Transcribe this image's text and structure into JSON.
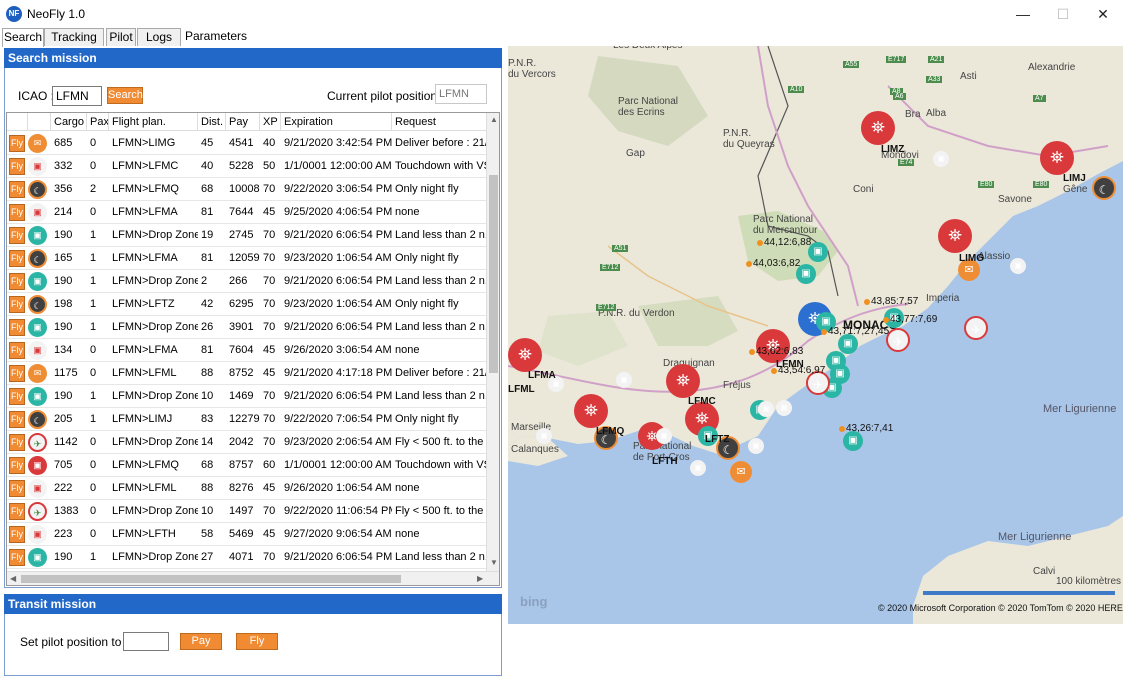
{
  "window": {
    "title": "NeoFly 1.0",
    "minimize": "—",
    "maximize": "☐",
    "close": "✕"
  },
  "tabs": [
    "Search",
    "Tracking",
    "Pilot",
    "Logs",
    "Parameters"
  ],
  "search_mission": {
    "header": "Search mission",
    "icao_label": "ICAO :",
    "icao_value": "LFMN",
    "search_button": "Search",
    "current_pos_label": "Current pilot position :",
    "current_pos_placeholder": "LFMN"
  },
  "grid": {
    "fly_label": "Fly",
    "columns": [
      "Cargo",
      "Pax",
      "Flight plan.",
      "Dist.",
      "Pay",
      "XP",
      "Expiration",
      "Request"
    ],
    "rows": [
      {
        "icon": "mail",
        "cargo": "685",
        "pax": "0",
        "plan": "LFMN>LIMG",
        "dist": "45",
        "pay": "4541",
        "xp": "40",
        "exp": "9/21/2020 3:42:54 PM",
        "req": "Deliver before : 21/0"
      },
      {
        "icon": "cargo",
        "cargo": "332",
        "pax": "0",
        "plan": "LFMN>LFMC",
        "dist": "40",
        "pay": "5228",
        "xp": "50",
        "exp": "1/1/0001 12:00:00 AM",
        "req": "Touchdown with VS"
      },
      {
        "icon": "night",
        "cargo": "356",
        "pax": "2",
        "plan": "LFMN>LFMQ",
        "dist": "68",
        "pay": "10008",
        "xp": "70",
        "exp": "9/22/2020 3:06:54 PM",
        "req": "Only night fly"
      },
      {
        "icon": "cargo",
        "cargo": "214",
        "pax": "0",
        "plan": "LFMN>LFMA",
        "dist": "81",
        "pay": "7644",
        "xp": "45",
        "exp": "9/25/2020 4:06:54 PM",
        "req": "none"
      },
      {
        "icon": "drop",
        "cargo": "190",
        "pax": "1",
        "plan": "LFMN>Drop Zone",
        "dist": "19",
        "pay": "2745",
        "xp": "70",
        "exp": "9/21/2020 6:06:54 PM",
        "req": "Land less than 2 n.m"
      },
      {
        "icon": "night",
        "cargo": "165",
        "pax": "1",
        "plan": "LFMN>LFMA",
        "dist": "81",
        "pay": "12059",
        "xp": "70",
        "exp": "9/23/2020 1:06:54 AM",
        "req": "Only night fly"
      },
      {
        "icon": "drop",
        "cargo": "190",
        "pax": "1",
        "plan": "LFMN>Drop Zone",
        "dist": "2",
        "pay": "266",
        "xp": "70",
        "exp": "9/21/2020 6:06:54 PM",
        "req": "Land less than 2 n.m"
      },
      {
        "icon": "night",
        "cargo": "198",
        "pax": "1",
        "plan": "LFMN>LFTZ",
        "dist": "42",
        "pay": "6295",
        "xp": "70",
        "exp": "9/23/2020 1:06:54 AM",
        "req": "Only night fly"
      },
      {
        "icon": "drop",
        "cargo": "190",
        "pax": "1",
        "plan": "LFMN>Drop Zone",
        "dist": "26",
        "pay": "3901",
        "xp": "70",
        "exp": "9/21/2020 6:06:54 PM",
        "req": "Land less than 2 n.m"
      },
      {
        "icon": "cargo",
        "cargo": "134",
        "pax": "0",
        "plan": "LFMN>LFMA",
        "dist": "81",
        "pay": "7604",
        "xp": "45",
        "exp": "9/26/2020 3:06:54 AM",
        "req": "none"
      },
      {
        "icon": "mail",
        "cargo": "1175",
        "pax": "0",
        "plan": "LFMN>LFML",
        "dist": "88",
        "pay": "8752",
        "xp": "45",
        "exp": "9/21/2020 4:17:18 PM",
        "req": "Deliver before : 21/0"
      },
      {
        "icon": "drop",
        "cargo": "190",
        "pax": "1",
        "plan": "LFMN>Drop Zone",
        "dist": "10",
        "pay": "1469",
        "xp": "70",
        "exp": "9/21/2020 6:06:54 PM",
        "req": "Land less than 2 n.m"
      },
      {
        "icon": "night",
        "cargo": "205",
        "pax": "1",
        "plan": "LFMN>LIMJ",
        "dist": "83",
        "pay": "12279",
        "xp": "70",
        "exp": "9/22/2020 7:06:54 PM",
        "req": "Only night fly"
      },
      {
        "icon": "lowfly",
        "cargo": "1142",
        "pax": "0",
        "plan": "LFMN>Drop Zone",
        "dist": "14",
        "pay": "2042",
        "xp": "70",
        "exp": "9/23/2020 2:06:54 AM",
        "req": "Fly < 500 ft. to the D"
      },
      {
        "icon": "touch",
        "cargo": "705",
        "pax": "0",
        "plan": "LFMN>LFMQ",
        "dist": "68",
        "pay": "8757",
        "xp": "60",
        "exp": "1/1/0001 12:00:00 AM",
        "req": "Touchdown with VS"
      },
      {
        "icon": "cargo",
        "cargo": "222",
        "pax": "0",
        "plan": "LFMN>LFML",
        "dist": "88",
        "pay": "8276",
        "xp": "45",
        "exp": "9/26/2020 1:06:54 AM",
        "req": "none"
      },
      {
        "icon": "lowfly",
        "cargo": "1383",
        "pax": "0",
        "plan": "LFMN>Drop Zone",
        "dist": "10",
        "pay": "1497",
        "xp": "70",
        "exp": "9/22/2020 11:06:54 PM",
        "req": "Fly < 500 ft. to the D"
      },
      {
        "icon": "cargo",
        "cargo": "223",
        "pax": "0",
        "plan": "LFMN>LFTH",
        "dist": "58",
        "pay": "5469",
        "xp": "45",
        "exp": "9/27/2020 9:06:54 AM",
        "req": "none"
      },
      {
        "icon": "drop",
        "cargo": "190",
        "pax": "1",
        "plan": "LFMN>Drop Zone",
        "dist": "27",
        "pay": "4071",
        "xp": "70",
        "exp": "9/21/2020 6:06:54 PM",
        "req": "Land less than 2 n.m"
      }
    ]
  },
  "transit_mission": {
    "header": "Transit mission",
    "set_pos_label": "Set pilot position to :",
    "pos_value": "",
    "pay_button": "Pay",
    "fly_button": "Fly"
  },
  "map": {
    "place_labels": [
      {
        "t": "Les Deux Alpes"
      },
      {
        "t": "P.N.R.\ndu Vercors"
      },
      {
        "t": "Parc National\ndes Ecrins"
      },
      {
        "t": "P.N.R.\ndu Queyras"
      },
      {
        "t": "Gap"
      },
      {
        "t": "Alexandrie"
      },
      {
        "t": "Asti"
      },
      {
        "t": "Alba"
      },
      {
        "t": "Bra"
      },
      {
        "t": "Coni"
      },
      {
        "t": "Mondovi"
      },
      {
        "t": "Savone"
      },
      {
        "t": "Gêne"
      },
      {
        "t": "Parc National\ndu Mercantour"
      },
      {
        "t": "Alassio"
      },
      {
        "t": "Imperia"
      },
      {
        "t": "P.N.R. du Verdon"
      },
      {
        "t": "Draguignan"
      },
      {
        "t": "Fréjus"
      },
      {
        "t": "MONACO"
      },
      {
        "t": "Marseille"
      },
      {
        "t": "Calanques"
      },
      {
        "t": "Parc national\nde Port-Cros"
      },
      {
        "t": "Mer Ligurienne"
      },
      {
        "t": "Mer Ligurienne"
      },
      {
        "t": "Calvi"
      }
    ],
    "airport_labels": [
      "LIMJ",
      "LIMZ",
      "LIMG",
      "LFMC",
      "LFTZ",
      "LFMQ",
      "LFTH",
      "LFMA",
      "LFML",
      "LFMN"
    ],
    "coord_labels": [
      "44,12:6,88",
      "44,03:6,82",
      "43,85:7,57",
      "43,77:7,69",
      "43,71:7,27,45",
      "43,62:6,83",
      "43,54:6,97",
      "43,26:7,41"
    ],
    "road_labels": [
      "A51",
      "E712",
      "E712",
      "A8",
      "E80",
      "A10",
      "A6",
      "A21",
      "A7",
      "E717",
      "A55",
      "A33",
      "E74",
      "E80"
    ],
    "scale": "100 kilomètres",
    "bing": "bing",
    "copyright": "© 2020 Microsoft Corporation   © 2020 TomTom © 2020 HERE",
    "colors": {
      "sea": "#a9c6e8",
      "land": "#e9e6d8",
      "park": "#cfdcb8",
      "mountain": "#d8d4c2",
      "tower": "#d9393b",
      "drop": "#2bb5a5",
      "night": "#404040",
      "mail": "#ef8d35",
      "pilot": "#2b6fd0"
    }
  }
}
